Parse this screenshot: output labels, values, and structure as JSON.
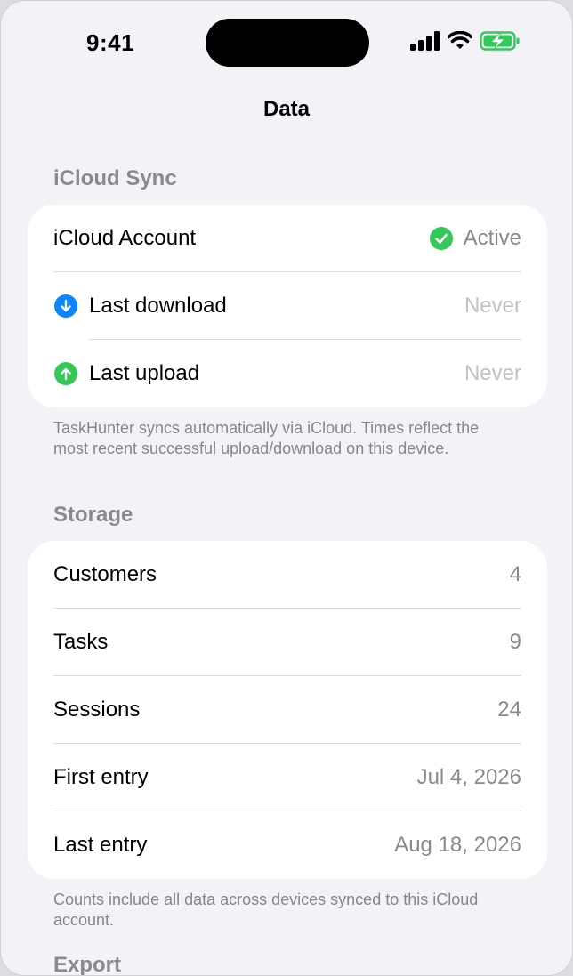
{
  "status_bar": {
    "time": "9:41"
  },
  "nav": {
    "title": "Data"
  },
  "icloud": {
    "header": "iCloud Sync",
    "account_label": "iCloud Account",
    "account_status": "Active",
    "last_download_label": "Last download",
    "last_download_value": "Never",
    "last_upload_label": "Last upload",
    "last_upload_value": "Never",
    "footnote": "TaskHunter syncs automatically via iCloud. Times reflect the most recent successful upload/download on this device."
  },
  "storage": {
    "header": "Storage",
    "rows": [
      {
        "label": "Customers",
        "value": "4"
      },
      {
        "label": "Tasks",
        "value": "9"
      },
      {
        "label": "Sessions",
        "value": "24"
      },
      {
        "label": "First entry",
        "value": "Jul 4, 2026"
      },
      {
        "label": "Last entry",
        "value": "Aug 18, 2026"
      }
    ],
    "footnote": "Counts include all data across devices synced to this iCloud account."
  },
  "export": {
    "header": "Export"
  },
  "colors": {
    "accent_blue": "#0a84ff",
    "success_green": "#34c759",
    "background": "#f2f2f7"
  },
  "icons": [
    "cellular-signal-icon",
    "wifi-icon",
    "battery-charging-icon",
    "checkmark-circle-icon",
    "download-arrow-icon",
    "upload-arrow-icon"
  ]
}
